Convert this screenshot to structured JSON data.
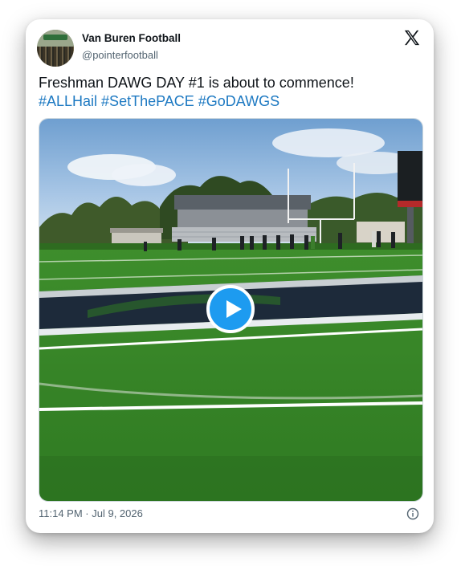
{
  "author": {
    "display_name": "Van Buren Football",
    "handle": "@pointerfootball"
  },
  "tweet": {
    "text": "Freshman DAWG DAY #1 is about to commence!",
    "hashtags": [
      "#ALLHail",
      "#SetThePACE",
      "#GoDAWGS"
    ],
    "timestamp": "11:14 PM · Jul 9, 2026"
  },
  "icons": {
    "brand": "x-logo-icon",
    "media_control": "play-icon",
    "info": "info-icon"
  },
  "colors": {
    "link": "#1d79c2",
    "play_button": "#1d9bf0",
    "text": "#0f1419",
    "muted": "#536471"
  }
}
